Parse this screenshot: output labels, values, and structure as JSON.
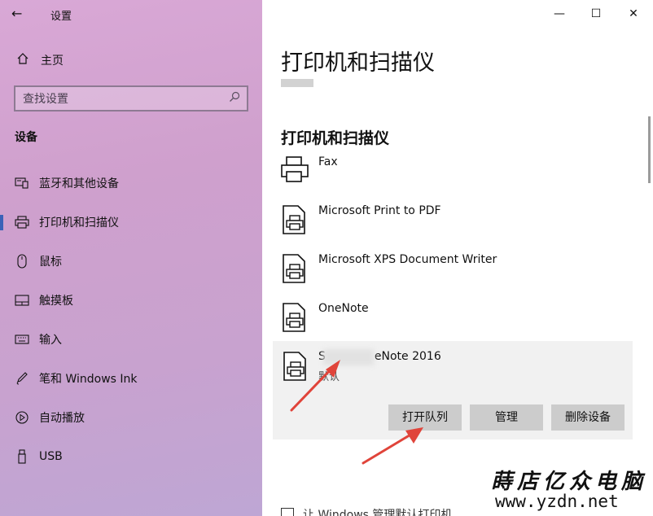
{
  "window": {
    "title": "设置",
    "back_icon": "←",
    "minimize_icon": "—",
    "maximize_icon": "☐",
    "close_icon": "✕"
  },
  "sidebar": {
    "home_label": "主页",
    "search_placeholder": "查找设置",
    "section_title": "设备",
    "items": [
      {
        "label": "蓝牙和其他设备",
        "icon": "bluetooth-devices-icon",
        "active": false
      },
      {
        "label": "打印机和扫描仪",
        "icon": "printer-icon",
        "active": true
      },
      {
        "label": "鼠标",
        "icon": "mouse-icon",
        "active": false
      },
      {
        "label": "触摸板",
        "icon": "touchpad-icon",
        "active": false
      },
      {
        "label": "输入",
        "icon": "keyboard-icon",
        "active": false
      },
      {
        "label": "笔和 Windows Ink",
        "icon": "pen-icon",
        "active": false
      },
      {
        "label": "自动播放",
        "icon": "autoplay-icon",
        "active": false
      },
      {
        "label": "USB",
        "icon": "usb-icon",
        "active": false
      }
    ]
  },
  "main": {
    "page_title": "打印机和扫描仪",
    "list_title": "打印机和扫描仪",
    "printers": [
      {
        "name": "Fax",
        "icon": "fax-icon"
      },
      {
        "name": "Microsoft Print to PDF",
        "icon": "printer-document-icon"
      },
      {
        "name": "Microsoft XPS Document Writer",
        "icon": "printer-document-icon"
      },
      {
        "name": "OneNote",
        "icon": "printer-document-icon"
      }
    ],
    "selected_printer": {
      "name_prefix": "S",
      "name_suffix": "eNote 2016",
      "status": "默认",
      "buttons": {
        "open_queue": "打开队列",
        "manage": "管理",
        "remove": "删除设备"
      }
    },
    "bottom_option": "让 Windows 管理默认打印机"
  },
  "watermark": {
    "site_name": "蒔店亿众电脑",
    "url": "www.yzdn.net"
  },
  "colors": {
    "sidebar_top": "#d9a8d6",
    "sidebar_bottom": "#bea6d4",
    "accent": "#3a62b8",
    "annotation_arrow": "#e0443a",
    "button_bg": "#cccccc"
  }
}
